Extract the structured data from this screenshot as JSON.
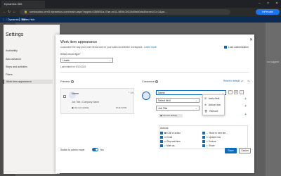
{
  "browser": {
    "tab_title": "Dynamics 365",
    "url": "contosoinc.crm3.dynamics.com/main.aspx?appid=0355f51a-f7ae-ec11-983f-0022480b80dd&forceUCI=1&pa...",
    "inprivate_label": "InPrivate"
  },
  "app": {
    "name": "Dynamics 365",
    "hub": "Sales Hub"
  },
  "settings": {
    "title": "Settings",
    "items": [
      {
        "label": "Availability"
      },
      {
        "label": "Auto advance"
      },
      {
        "label": "Steps and activities"
      },
      {
        "label": "Filters"
      },
      {
        "label": "Work item appearance"
      }
    ]
  },
  "dialog": {
    "title": "Work item appearance",
    "subtitle": "Customize the way your work items look on your sales accelerator workspace.",
    "learn_more": "Learn more",
    "lock_customization": "Lock customization",
    "record_type_label": "Select record type",
    "record_type_value": "Leads",
    "last_edited": "Last edited on 9/12/2022",
    "preview_label": "Preview",
    "customize_label": "Customize",
    "reset_default": "Reset to default",
    "preview_card": {
      "name": "Name",
      "subtitle": "Job Title • Company Name",
      "next_activity": "Up next activity",
      "due": "DUE DATE"
    },
    "fields": [
      {
        "value": "Name"
      },
      {
        "value": "Select field"
      },
      {
        "value": "Job Title"
      }
    ],
    "next_activity_tag": "Up next activity",
    "menu": [
      {
        "icon": "add-field-icon",
        "label": "Add a field"
      },
      {
        "icon": "add-icon-icon",
        "label": "Add an icon"
      },
      {
        "icon": "trash-icon",
        "label": "Remove"
      }
    ],
    "actions_label": "Actions",
    "actions": [
      {
        "label": "Call or action",
        "checked": true
      },
      {
        "label": "Email",
        "checked": true
      },
      {
        "label": "Skip wait time",
        "checked": true
      },
      {
        "label": "Mark as...",
        "checked": true
      },
      {
        "label": "Move to next ste...",
        "checked": true
      },
      {
        "label": "Update now",
        "checked": true
      },
      {
        "label": "Snooze",
        "checked": true
      },
      {
        "label": "Share",
        "checked": true
      }
    ],
    "switch_admin": "Switch to admin mode",
    "toggle_value": "Yes",
    "save": "Save",
    "cancel": "Cancel"
  },
  "background": {
    "right_text": "no suggest"
  },
  "colors": {
    "accent": "#0f6cbd",
    "header": "#0b2a55"
  }
}
